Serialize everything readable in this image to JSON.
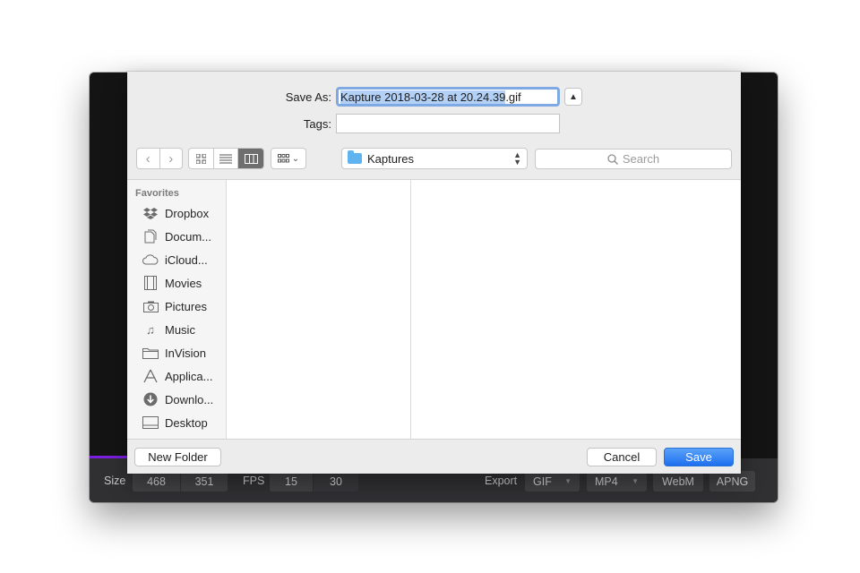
{
  "kap": {
    "size_label": "Size",
    "width": "468",
    "height": "351",
    "fps_label": "FPS",
    "fps_options": [
      "15",
      "30"
    ],
    "export_label": "Export",
    "formats": [
      "GIF",
      "MP4",
      "WebM",
      "APNG"
    ],
    "accent_color": "#7a1fe0"
  },
  "sheet": {
    "save_as_label": "Save As:",
    "filename_selected": "Kapture 2018-03-28 at 20.24.39",
    "filename_ext": ".gif",
    "tags_label": "Tags:",
    "tags_value": "",
    "location": "Kaptures",
    "search_placeholder": "Search",
    "sidebar": {
      "header": "Favorites",
      "items": [
        {
          "label": "Dropbox",
          "icon": "dropbox-icon"
        },
        {
          "label": "Docum...",
          "icon": "documents-icon"
        },
        {
          "label": "iCloud...",
          "icon": "cloud-icon"
        },
        {
          "label": "Movies",
          "icon": "film-icon"
        },
        {
          "label": "Pictures",
          "icon": "camera-icon"
        },
        {
          "label": "Music",
          "icon": "music-note-icon"
        },
        {
          "label": "InVision",
          "icon": "folder-icon"
        },
        {
          "label": "Applica...",
          "icon": "applications-icon"
        },
        {
          "label": "Downlo...",
          "icon": "download-icon"
        },
        {
          "label": "Desktop",
          "icon": "desktop-icon"
        }
      ]
    },
    "new_folder_label": "New Folder",
    "cancel_label": "Cancel",
    "save_label": "Save",
    "save_color": "#1e6ff0"
  }
}
